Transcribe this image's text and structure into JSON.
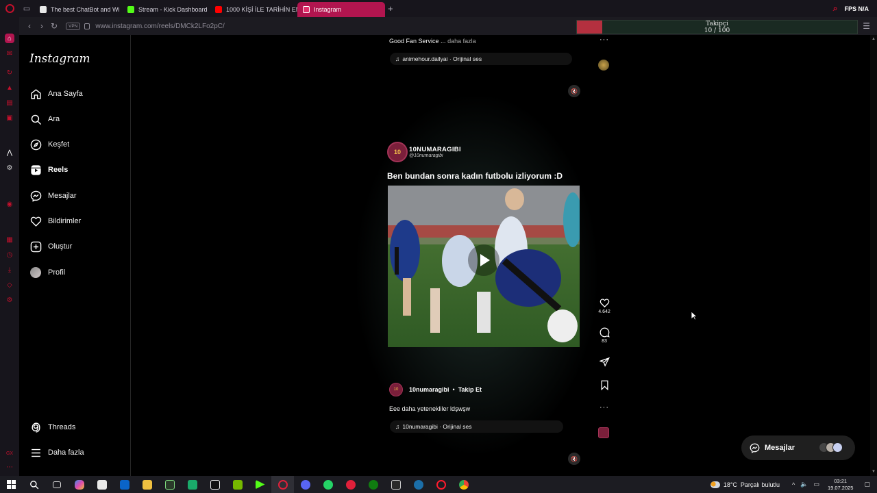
{
  "browser": {
    "tabs": [
      {
        "label": "The best ChatBot and Wi",
        "color": "#ffffff",
        "active": false
      },
      {
        "label": "Stream - Kick Dashboard",
        "color": "#53fc18",
        "active": false
      },
      {
        "label": "1000 KİŞİ İLE TARİHİN EN",
        "color": "#ff0000",
        "active": false
      },
      {
        "label": "Instagram",
        "color": "#e1306c",
        "active": true
      }
    ],
    "tab_add": "+",
    "fps_label": "FPS N/A",
    "url": "www.instagram.com/reels/DMCk2LFo2pC/",
    "vpn_label": "VPN"
  },
  "follower_widget": {
    "title": "Takipçi",
    "count_text": "10 / 100",
    "progress": 0.09
  },
  "instagram": {
    "logo": "Instagram",
    "nav": [
      {
        "label": "Ana Sayfa",
        "icon": "home-icon"
      },
      {
        "label": "Ara",
        "icon": "search-icon"
      },
      {
        "label": "Keşfet",
        "icon": "explore-icon"
      },
      {
        "label": "Reels",
        "icon": "reels-icon"
      },
      {
        "label": "Mesajlar",
        "icon": "messenger-icon"
      },
      {
        "label": "Bildirimler",
        "icon": "heart-icon"
      },
      {
        "label": "Oluştur",
        "icon": "create-icon"
      },
      {
        "label": "Profil",
        "icon": "profile-avatar"
      }
    ],
    "bottom_nav": [
      {
        "label": "Threads",
        "icon": "threads-icon"
      },
      {
        "label": "Daha fazla",
        "icon": "menu-icon"
      }
    ]
  },
  "prev_reel": {
    "caption": "Good Fan Service ...",
    "more": "daha fazla",
    "audio": "animehour.dailyai · Orijinal ses"
  },
  "reel": {
    "overlay_account": "10NUMARAGIBI",
    "overlay_handle": "@10numaragibi",
    "overlay_title": "Ben bundan sonra kadın futbolu izliyorum :D",
    "likes": "4.642",
    "comments": "83",
    "author": "10numaragibi",
    "separator": "•",
    "follow": "Takip Et",
    "caption": "Eee daha yetenekliler ldşwşw",
    "audio": "10numaragibi · Orijinal ses"
  },
  "messages_button": "Mesajlar",
  "taskbar": {
    "temperature": "18°C",
    "weather": "Parçalı bulutlu",
    "time": "03:21",
    "date": "19.07.2025"
  }
}
